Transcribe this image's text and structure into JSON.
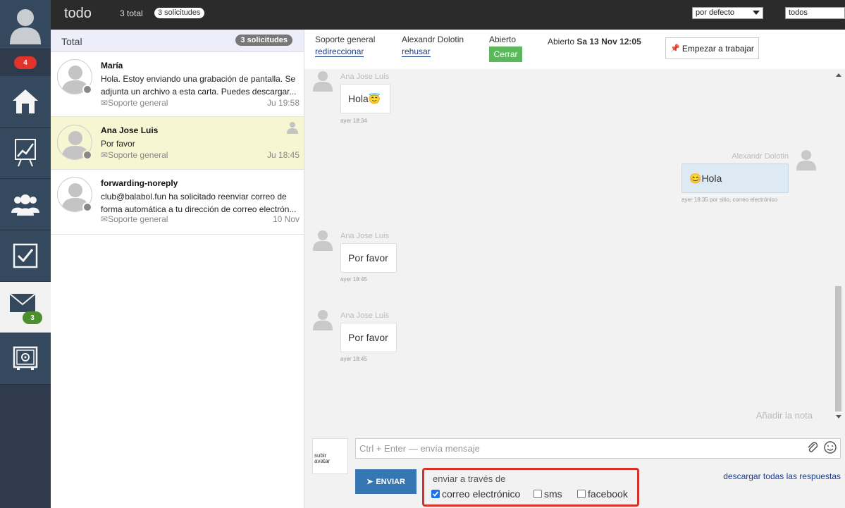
{
  "sidebar": {
    "notif_badge": "4",
    "mail_badge": "3",
    "items": [
      {
        "icon": "home-icon"
      },
      {
        "icon": "chart-board-icon"
      },
      {
        "icon": "users-icon"
      },
      {
        "icon": "checkbox-icon"
      },
      {
        "icon": "mail-icon"
      },
      {
        "icon": "safe-settings-icon"
      }
    ]
  },
  "topbar": {
    "title": "todo",
    "total": "3 total",
    "requests": "3 solicitudes",
    "sort_value": "por defecto",
    "filter_value": "todos"
  },
  "list": {
    "header_label": "Total",
    "header_count": "3 solicitudes",
    "conversations": [
      {
        "name": "María",
        "preview": "Hola. Estoy enviando una grabación de pantalla. Se adjunta un archivo a esta carta. Puedes descargar...",
        "dept": "Soporte general",
        "time": "Ju 19:58"
      },
      {
        "name": "Ana Jose Luis",
        "preview": "Por favor",
        "dept": "Soporte general",
        "time": "Ju 18:45"
      },
      {
        "name": "forwarding-noreply",
        "preview": "club@balabol.fun ha solicitado reenviar correo de forma automática a tu dirección de correo electrón...",
        "dept": "Soporte general",
        "time": "10 Nov"
      }
    ]
  },
  "ticket": {
    "dept": "Soporte general",
    "redirect": "redireccionar",
    "agent": "Alexandr Dolotin",
    "refuse": "rehusar",
    "status": "Abierto",
    "close": "Cerrar",
    "opened_label": "Abierto",
    "opened_date": "Sa 13 Nov 12:05",
    "start_work": "Empezar a trabajar"
  },
  "messages": [
    {
      "author": "Ana Jose Luis",
      "text": "Hola",
      "emoji": "😇",
      "time": "ayer 18:34"
    },
    {
      "author": "Alexandr Dolotin",
      "text": "Hola",
      "emoji": "😊",
      "time": "ayer 18:35 por sitio, correo electrónico"
    },
    {
      "author": "Ana Jose Luis",
      "text": "Por favor",
      "time": "ayer 18:45"
    },
    {
      "author": "Ana Jose Luis",
      "text": "Por favor",
      "time": "ayer 18:45"
    }
  ],
  "add_note": "Añadir la nota",
  "composer": {
    "upload_avatar": "subir avatar",
    "placeholder": "Ctrl + Enter — envía mensaje",
    "send": "ENVIAR",
    "via_title": "enviar a través de",
    "channels": [
      {
        "label": "correo electrónico",
        "checked": true
      },
      {
        "label": "sms",
        "checked": false
      },
      {
        "label": "facebook",
        "checked": false
      }
    ],
    "download_all": "descargar todas las respuestas"
  }
}
